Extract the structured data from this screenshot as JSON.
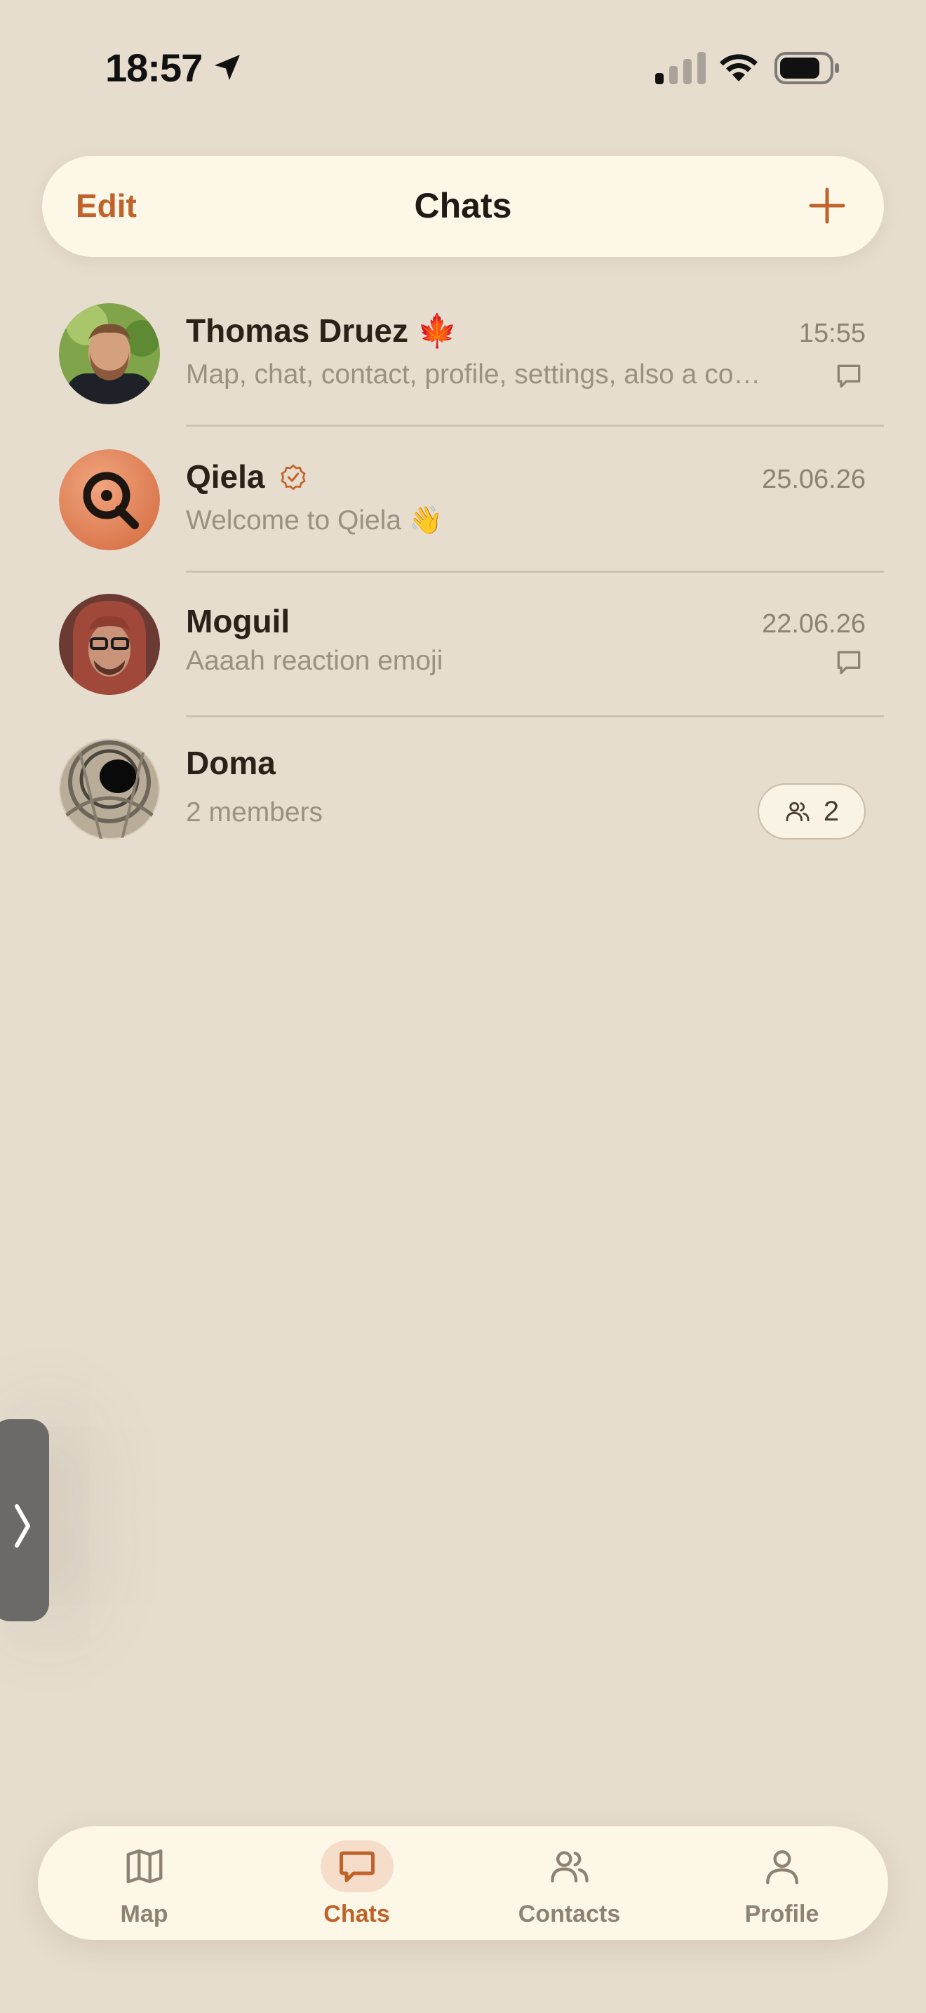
{
  "status_bar": {
    "time": "18:57",
    "icons": [
      "location-arrow-icon",
      "signal-icon",
      "wifi-icon",
      "battery-icon"
    ]
  },
  "header": {
    "edit_label": "Edit",
    "title": "Chats",
    "add_icon": "plus-icon"
  },
  "colors": {
    "accent": "#c0632b",
    "background": "#e6ddcf",
    "surface": "#fdf7e8",
    "muted_text": "#9c907f"
  },
  "chats": [
    {
      "name": "Thomas Druez 🍁",
      "time": "15:55",
      "preview": "Map, chat, contact, profile, settings, also a co…",
      "icon": "message-bubble-icon"
    },
    {
      "name": "Qiela",
      "time": "25.06.26",
      "preview": "Welcome to Qiela 👋",
      "icon": "verified-badge-icon"
    },
    {
      "name": "Moguil",
      "time": "22.06.26",
      "preview": "Aaaah reaction emoji",
      "icon": "message-bubble-icon"
    },
    {
      "name": "Doma",
      "time": "",
      "preview": "2 members",
      "members_count": "2"
    }
  ],
  "tabs": [
    {
      "label": "Map",
      "icon": "map-icon"
    },
    {
      "label": "Chats",
      "icon": "chat-icon",
      "active": true
    },
    {
      "label": "Contacts",
      "icon": "contacts-icon"
    },
    {
      "label": "Profile",
      "icon": "profile-icon"
    }
  ]
}
